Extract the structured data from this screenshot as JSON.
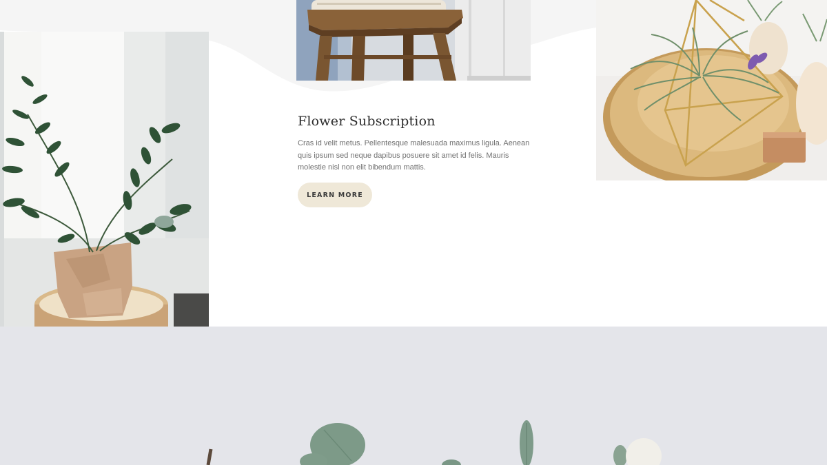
{
  "feature": {
    "title": "Flower Subscription",
    "body": "Cras id velit metus. Pellentesque malesuada maximus ligula. Aenean quis ipsum sed neque dapibus posuere sit amet id felis. Mauris molestie nisl non elit bibendum mattis.",
    "button_label": "LEARN MORE"
  },
  "images": {
    "left": "zz-plant-in-paper-pot-photo",
    "top_center": "wooden-stool-photo",
    "right": "air-plant-geometric-terrarium-photo",
    "bottom": "eucalyptus-flat-lay-photo"
  },
  "colors": {
    "button_bg": "#efe8d8",
    "title": "#2c2c2c",
    "body_text": "#6f6f6f",
    "bottom_band": "#e4e5ea",
    "wave": "#f5f5f5"
  }
}
